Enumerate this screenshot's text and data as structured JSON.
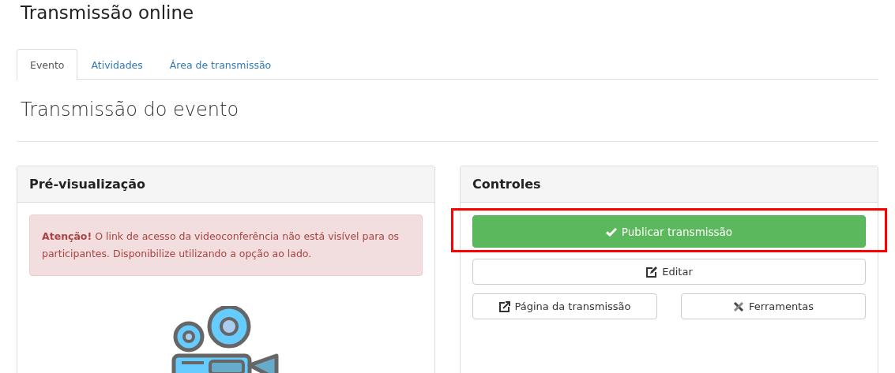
{
  "page_title": "Transmissão online",
  "tabs": [
    {
      "label": "Evento",
      "selected": true
    },
    {
      "label": "Atividades",
      "selected": false
    },
    {
      "label": "Área de transmissão",
      "selected": false
    }
  ],
  "section_title": "Transmissão do evento",
  "preview_panel": {
    "title": "Pré-visualização",
    "alert": "**Atenção!** O link de acesso da videoconferência não está visível para os participantes. Disponibilize utilizando a opção ao lado."
  },
  "controls_panel": {
    "title": "Controles",
    "buttons": [
      {
        "label": "Publicar transmissão",
        "kind": "success"
      },
      {
        "label": "Editar",
        "kind": "default"
      },
      {
        "label": "Página da transmissão",
        "kind": "default"
      },
      {
        "label": "Ferramentas",
        "kind": "default"
      }
    ]
  }
}
